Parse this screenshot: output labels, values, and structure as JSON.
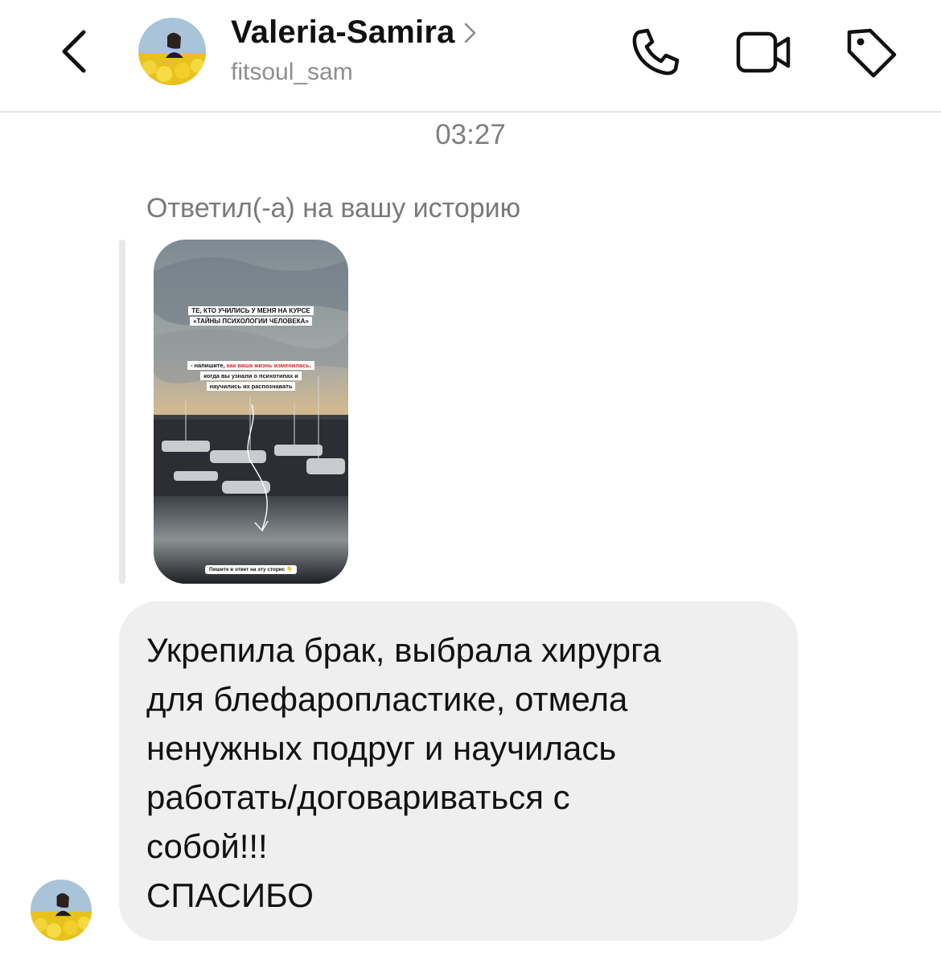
{
  "header": {
    "title": "Valeria-Samira",
    "username": "fitsoul_sam",
    "icons": [
      "back-arrow-icon",
      "chevron-right-icon",
      "phone-icon",
      "video-camera-icon",
      "tag-icon"
    ]
  },
  "chat": {
    "timestamp": "03:27",
    "reply_label": "Ответил(-а) на вашу историю",
    "story": {
      "caption_line1": "ТЕ, КТО УЧИЛИСЬ У МЕНЯ НА КУРСЕ",
      "caption_line2": "«ТАЙНЫ ПСИХОЛОГИИ ЧЕЛОВЕКА»",
      "prompt_prefix": "- напишите, ",
      "prompt_highlight": "как ваша жизнь изменилась,",
      "prompt_line2": "когда вы узнали о психотипах и",
      "prompt_line3": "научились их распознавать",
      "cta": "Пишите в ответ на эту сторис 👇",
      "highlight_color": "#d3262e"
    },
    "message_lines": [
      "Укрепила брак, выбрала хирурга",
      "для блефаропластике, отмела",
      "ненужных подруг и научилась",
      "работать/договариваться с",
      "собой!!!",
      "СПАСИБО"
    ]
  },
  "colors": {
    "bubble": "#efefef",
    "muted_text": "#8e8e8e",
    "divider": "#e6e6e6"
  }
}
